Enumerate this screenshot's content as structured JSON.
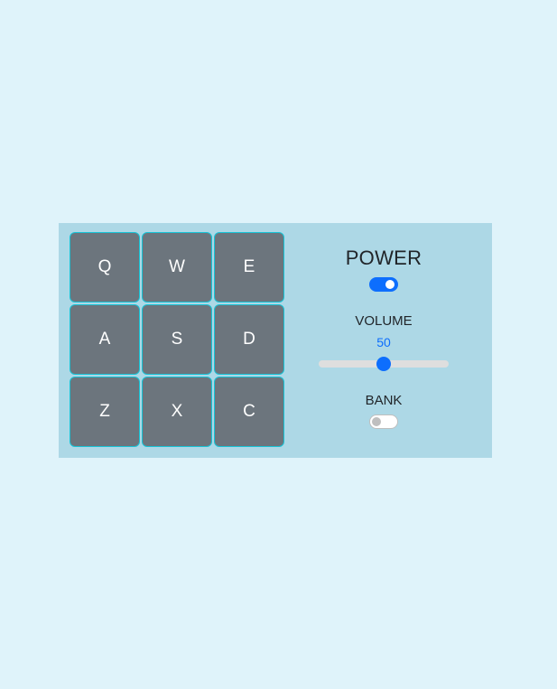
{
  "pads": [
    {
      "key": "Q"
    },
    {
      "key": "W"
    },
    {
      "key": "E"
    },
    {
      "key": "A"
    },
    {
      "key": "S"
    },
    {
      "key": "D"
    },
    {
      "key": "Z"
    },
    {
      "key": "X"
    },
    {
      "key": "C"
    }
  ],
  "power": {
    "label": "POWER",
    "on": true
  },
  "volume": {
    "label": "VOLUME",
    "value": "50",
    "min": 0,
    "max": 100
  },
  "bank": {
    "label": "BANK",
    "on": false
  },
  "colors": {
    "page_background": "#dff3fa",
    "panel_background": "#add8e6",
    "pad_background": "#6c757d",
    "pad_border": "#17c3d6",
    "accent": "#0d6efd"
  }
}
